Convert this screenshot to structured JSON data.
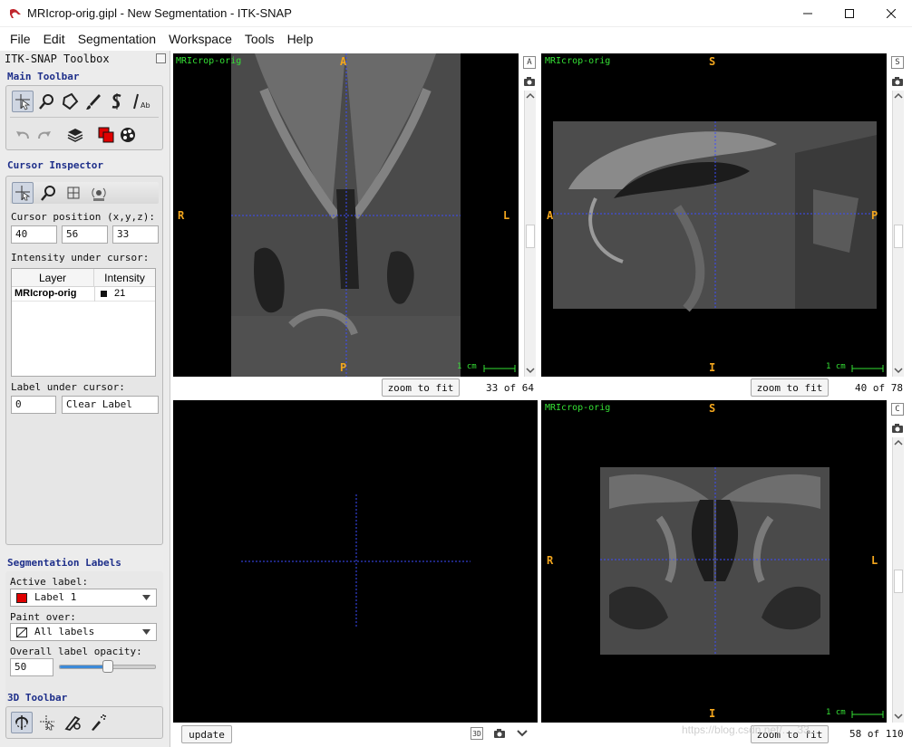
{
  "window": {
    "title": "MRIcrop-orig.gipl - New Segmentation - ITK-SNAP"
  },
  "menu": [
    "File",
    "Edit",
    "Segmentation",
    "Workspace",
    "Tools",
    "Help"
  ],
  "toolbox": {
    "title": "ITK-SNAP Toolbox",
    "main_toolbar_label": "Main Toolbar",
    "cursor_inspector_label": "Cursor Inspector",
    "cursor_position_label": "Cursor position (x,y,z):",
    "cursor_position": [
      "40",
      "56",
      "33"
    ],
    "intensity_label": "Intensity under cursor:",
    "table": {
      "headers": [
        "Layer",
        "Intensity"
      ],
      "rows": [
        {
          "layer": "MRIcrop-orig",
          "intensity": "21"
        }
      ]
    },
    "label_under_cursor_label": "Label under cursor:",
    "label_under_cursor_value": "0",
    "label_under_cursor_name": "Clear Label",
    "seg_labels_label": "Segmentation Labels",
    "active_label_label": "Active label:",
    "active_label": "Label 1",
    "active_label_color": "#e00000",
    "paint_over_label": "Paint over:",
    "paint_over": "All labels",
    "opacity_label": "Overall label opacity:",
    "opacity_value": "50",
    "opacity_fraction": 0.5,
    "toolbar3d_label": "3D Toolbar"
  },
  "views": {
    "axial": {
      "name": "MRIcrop-orig",
      "top": "A",
      "bottom": "P",
      "left": "R",
      "right": "L",
      "scale": "1 cm",
      "zoom_button": "zoom to fit",
      "slice": "33 of 64",
      "corner_btn": "A"
    },
    "sagittal": {
      "name": "MRIcrop-orig",
      "top": "S",
      "bottom": "I",
      "left": "A",
      "right": "P",
      "scale": "1 cm",
      "zoom_button": "zoom to fit",
      "slice": "40 of 78",
      "corner_btn": "S"
    },
    "view3d": {
      "update_button": "update"
    },
    "coronal": {
      "name": "MRIcrop-orig",
      "top": "S",
      "bottom": "I",
      "left": "R",
      "right": "L",
      "scale": "1 cm",
      "zoom_button": "zoom to fit",
      "slice": "58 of 110",
      "corner_btn": "C"
    }
  },
  "colors": {
    "section_heading": "#1e2f8a",
    "orientation_marker": "#f3a61d",
    "overlay_green": "#35e035",
    "crosshair": "#3c4cff"
  },
  "watermark": "https://blog.csdn.net/..._33..."
}
